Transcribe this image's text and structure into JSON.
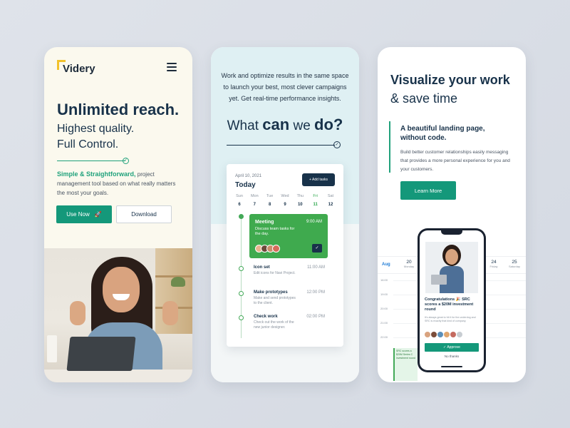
{
  "screen1": {
    "brand": "Videry",
    "headline": "Unlimited reach.",
    "subline1": "Highest quality.",
    "subline2": "Full Control.",
    "desc_highlight": "Simple & Straightforward,",
    "desc_rest": " project management tool based on what really matters the most your goals.",
    "use_now": "Use Now",
    "download": "Download"
  },
  "screen2": {
    "intro": "Work and optimize results in the same space to launch your best, most clever campaigns yet. Get real-time performance insights.",
    "what": "What",
    "can": "can",
    "we": "we",
    "do": "do?",
    "card": {
      "date": "April 10, 2021",
      "today": "Today",
      "add_tasks": "+ Add tasks",
      "days": [
        {
          "name": "Sun",
          "num": "6"
        },
        {
          "name": "Mon",
          "num": "7"
        },
        {
          "name": "Tue",
          "num": "8"
        },
        {
          "name": "Wed",
          "num": "9"
        },
        {
          "name": "Thu",
          "num": "10"
        },
        {
          "name": "Fri",
          "num": "11"
        },
        {
          "name": "Sat",
          "num": "12"
        }
      ],
      "meeting": {
        "title": "Meeting",
        "time": "9:00 AM",
        "desc": "Discuss team tasks for the day."
      },
      "tasks": [
        {
          "title": "Icon set",
          "time": "11:00 AM",
          "desc": "Edit icons for Navi Project."
        },
        {
          "title": "Make prototypes",
          "time": "12:00 PM",
          "desc": "Make and send prototypes to the client."
        },
        {
          "title": "Check work",
          "time": "02:00 PM",
          "desc": "Check out the work of the new junior designer."
        }
      ]
    }
  },
  "screen3": {
    "headline": "Visualize your work",
    "subline": "& save time",
    "subhead": "A beautiful landing page, without code.",
    "desc": "Build better customer relationships easily messaging that provides a more personal experience for you and your customers.",
    "learn_more": "Learn More",
    "calendar": {
      "month": "Aug",
      "cols": [
        {
          "n": "20",
          "w": "Monday"
        },
        {
          "n": "24",
          "w": "Friday"
        },
        {
          "n": "25",
          "w": "Saturday"
        }
      ],
      "times": [
        "16:00",
        "19:00",
        "20:00",
        "21:00",
        "22:00"
      ],
      "event": "SRC scores a $20M Series C investment round"
    },
    "phone": {
      "title": "Congratulations 🎉 SRC scores a $20M investment round",
      "desc": "It's always great to hit it for the underdog and SRC is exactly that kind of company.",
      "approve": "✓ Approve",
      "no_thanks": "No thanks"
    }
  },
  "colors": {
    "primary": "#14987a",
    "dark": "#18324a",
    "accent_green": "#3faa4e",
    "logo_yellow": "#f2c22b"
  }
}
